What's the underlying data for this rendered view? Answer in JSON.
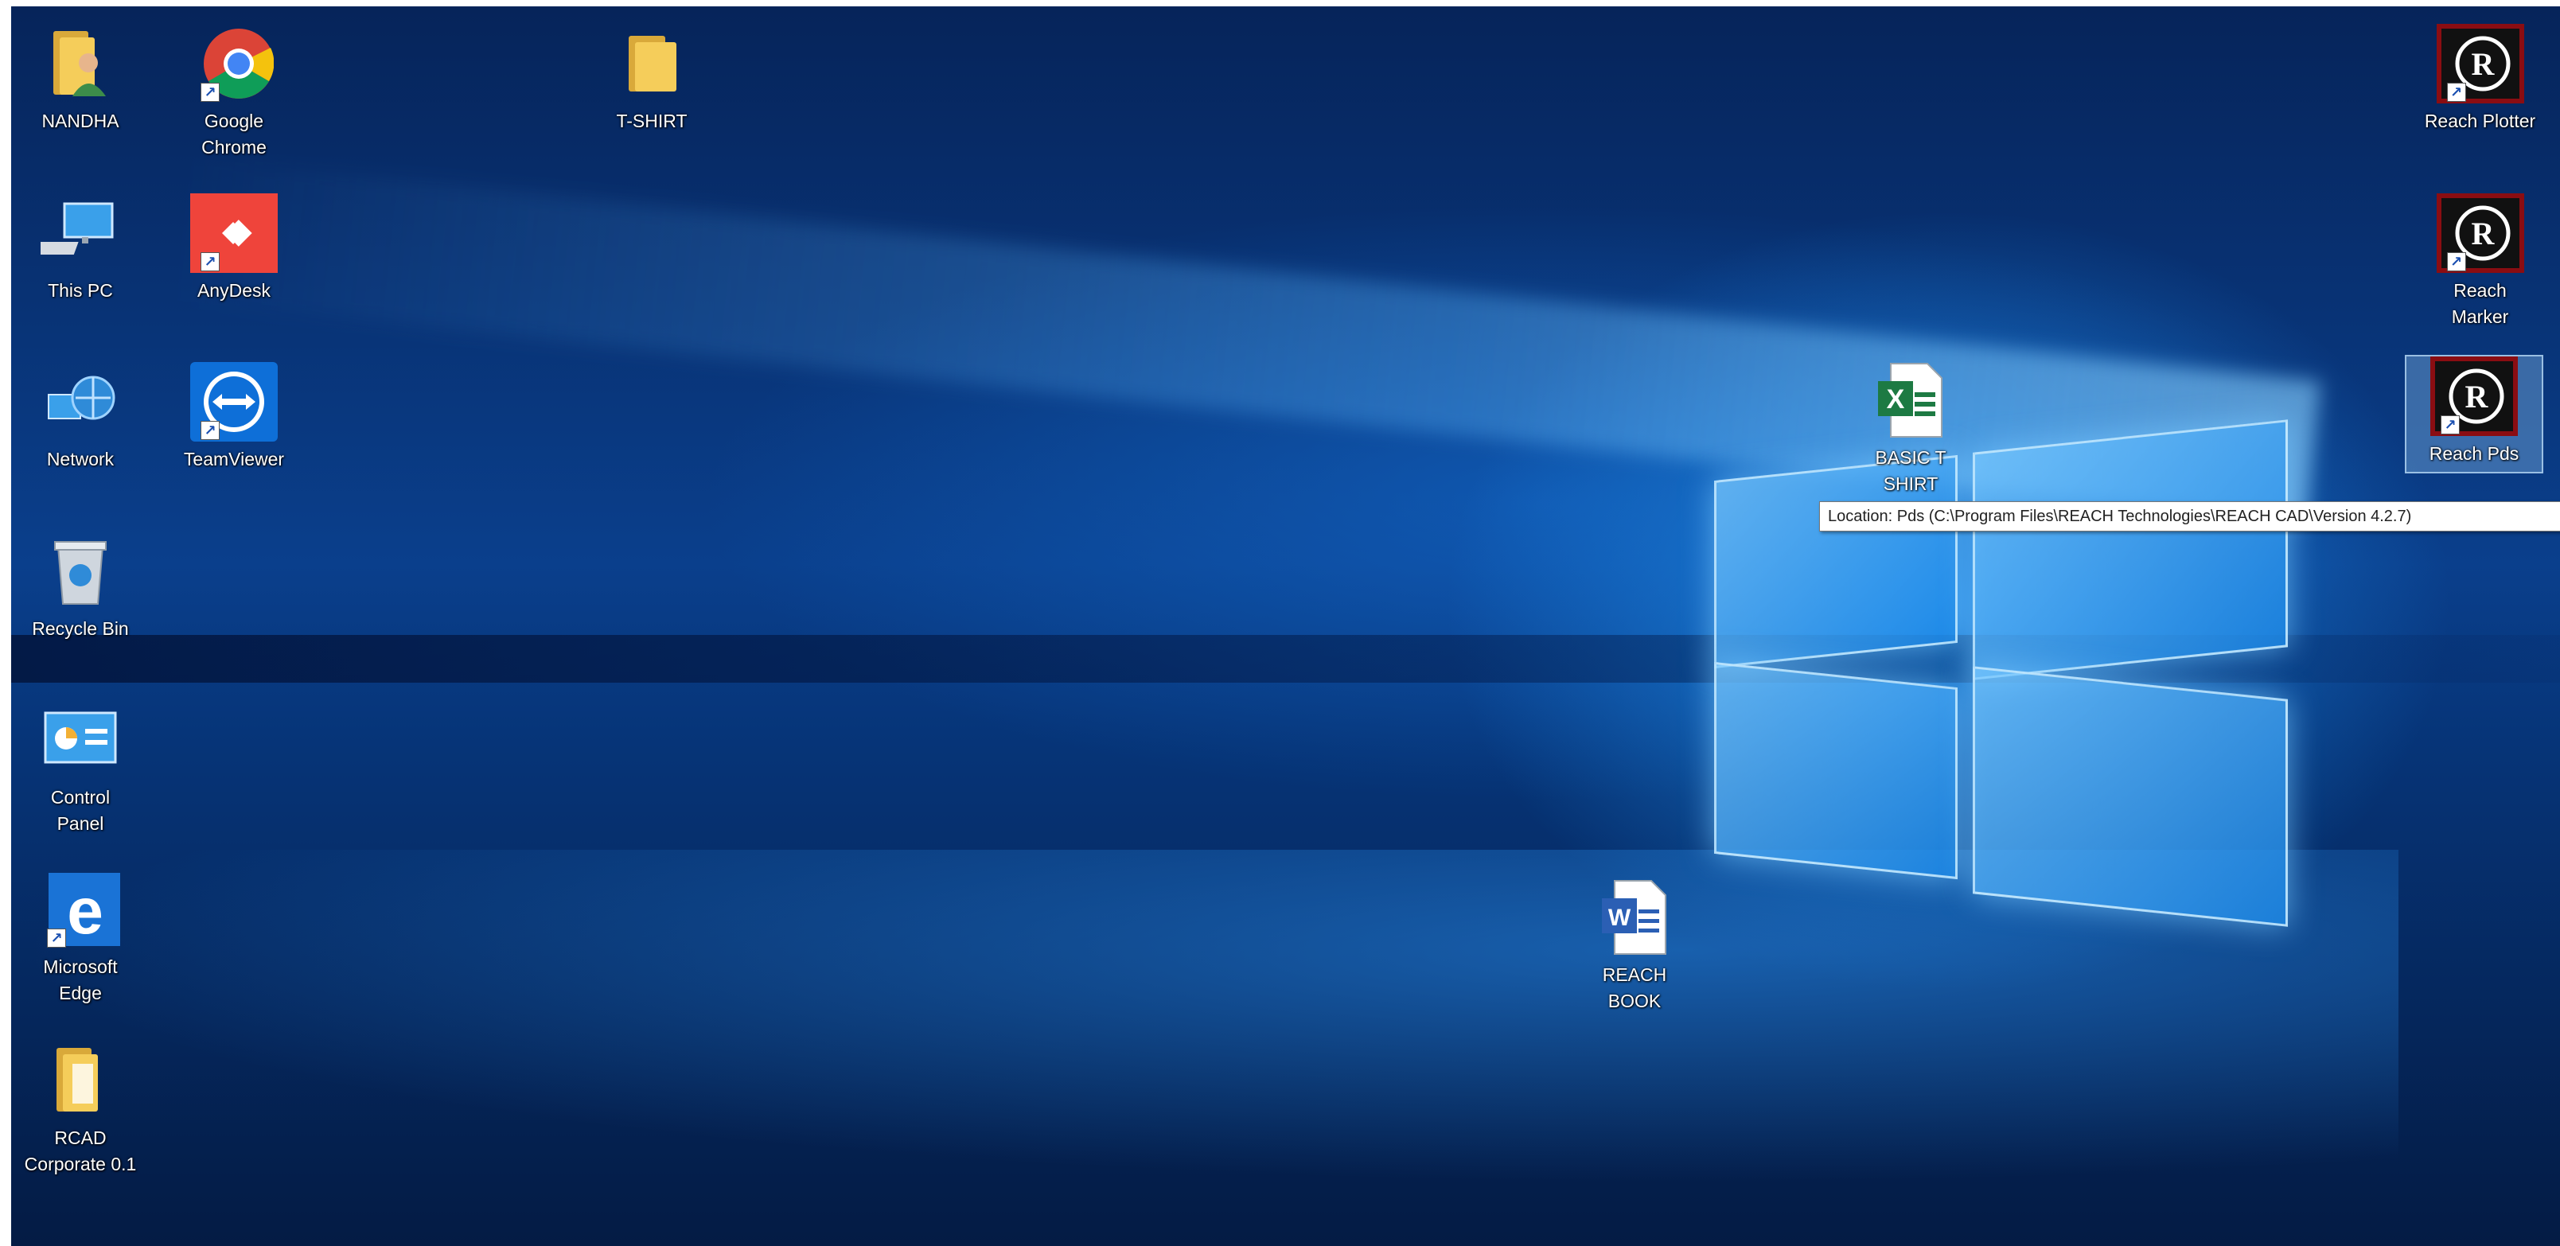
{
  "desktop": {
    "icons": {
      "nandha": "NANDHA",
      "chrome": "Google\nChrome",
      "tshirt": "T-SHIRT",
      "reach_plotter": "Reach Plotter",
      "this_pc": "This PC",
      "anydesk": "AnyDesk",
      "reach_marker": "Reach\nMarker",
      "network": "Network",
      "teamviewer": "TeamViewer",
      "basic_tshirt": "BASIC T\nSHIRT",
      "reach_pds": "Reach Pds",
      "recycle_bin": "Recycle Bin",
      "control_panel": "Control\nPanel",
      "edge": "Microsoft\nEdge",
      "reach_book": "REACH\nBOOK",
      "rcad": "RCAD\nCorporate 0.1"
    },
    "tooltip": "Location: Pds (C:\\Program Files\\REACH Technologies\\REACH CAD\\Version 4.2.7)"
  },
  "icon_names": {
    "reach": "reach-logo-icon",
    "excel": "excel-file-icon",
    "word": "word-file-icon"
  },
  "colors": {
    "wallpaper_dark": "#063477",
    "wallpaper_glow": "#1e8ceb",
    "excel_green": "#1d7a43",
    "word_blue": "#2b5fb4",
    "anydesk_red": "#ef443b",
    "teamviewer_blue": "#0e6fd8",
    "reach_red": "#8a0d12"
  }
}
